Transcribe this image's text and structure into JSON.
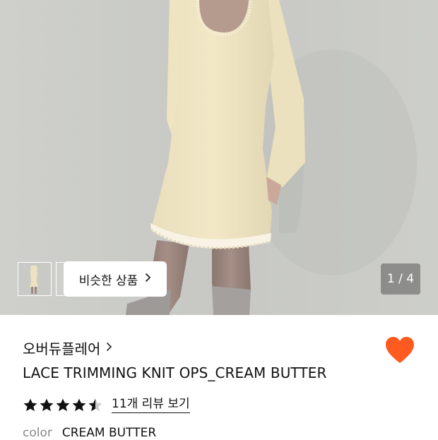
{
  "gallery": {
    "similar_button_label": "비슷한 상품",
    "page_counter": "1 / 4",
    "current_page": 1,
    "total_pages": 4
  },
  "product": {
    "brand": "오버듀플레어",
    "name": "LACE TRIMMING KNIT OPS_CREAM BUTTER",
    "rating": 4.5,
    "review_link_label": "11개 리뷰 보기",
    "favorited": true,
    "option": {
      "key": "color",
      "value": "CREAM BUTTER"
    }
  },
  "colors": {
    "heart": "#ff5a1f",
    "star": "#111111",
    "star_empty": "#cccccc",
    "dress": "#f0e6c4",
    "background": "#ffffff"
  },
  "icons": {
    "favorite": "heart-icon",
    "brand_arrow": "chevron-right-icon",
    "star": "star-icon"
  }
}
